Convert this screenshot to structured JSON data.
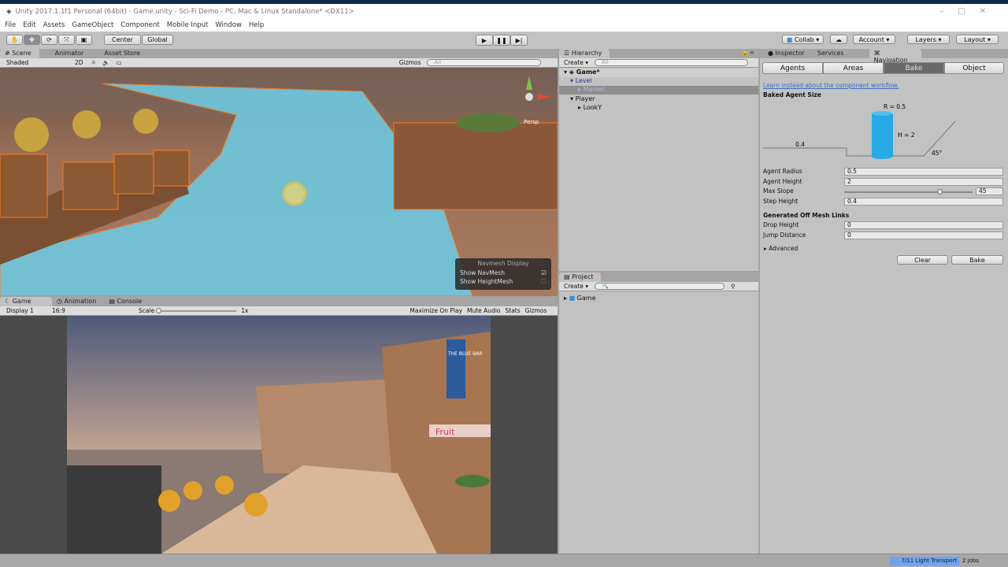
{
  "window": {
    "title": "Unity 2017.1.1f1 Personal (64bit) - Game.unity - Sci-Fi Demo - PC, Mac & Linux Standalone* <DX11>"
  },
  "menu": [
    "File",
    "Edit",
    "Assets",
    "GameObject",
    "Component",
    "Mobile Input",
    "Window",
    "Help"
  ],
  "toolbar": {
    "tools": [
      "hand-icon",
      "move-icon",
      "rotate-icon",
      "scale-icon",
      "rect-icon"
    ],
    "center": "Center",
    "global": "Global",
    "collab": "Collab",
    "account": "Account",
    "layers": "Layers",
    "layout": "Layout"
  },
  "scene": {
    "tabs": [
      "Scene",
      "Animator",
      "Asset Store"
    ],
    "shading": "Shaded",
    "mode2d": "2D",
    "gizmos": "Gizmos",
    "search_placeholder": "All",
    "persp": "Persp",
    "navmesh_display": {
      "title": "Navmesh Display",
      "show_navmesh": "Show NavMesh",
      "show_navmesh_checked": true,
      "show_heightmesh": "Show HeightMesh",
      "show_heightmesh_checked": false
    }
  },
  "game": {
    "tabs": [
      "Game",
      "Animation",
      "Console"
    ],
    "display": "Display 1",
    "aspect": "16:9",
    "scale_label": "Scale",
    "scale_value": "1x",
    "maximize": "Maximize On Play",
    "mute": "Mute Audio",
    "stats": "Stats",
    "gizmos": "Gizmos",
    "sign_bar": "THE BLUE BAR",
    "sign_fruit": "Fruit"
  },
  "hierarchy": {
    "tab": "Hierarchy",
    "create": "Create",
    "search_placeholder": "All",
    "scene": "Game*",
    "items": [
      {
        "label": "Level",
        "depth": 1
      },
      {
        "label": "Market",
        "depth": 2,
        "selected": true
      },
      {
        "label": "Player",
        "depth": 1
      },
      {
        "label": "LookY",
        "depth": 2
      }
    ]
  },
  "project": {
    "tab": "Project",
    "create": "Create",
    "items": [
      "Game"
    ]
  },
  "inspector": {
    "tabs": [
      "Inspector",
      "Services",
      "Navigation"
    ],
    "nav_tabs": [
      "Agents",
      "Areas",
      "Bake",
      "Object"
    ],
    "active_nav_tab": "Bake",
    "link": "Learn instead about the component workflow.",
    "baked_agent_size": "Baked Agent Size",
    "diagram": {
      "radius": "R = 0.5",
      "height": "H = 2",
      "step": "0.4",
      "slope": "45°"
    },
    "fields": [
      {
        "label": "Agent Radius",
        "value": "0.5"
      },
      {
        "label": "Agent Height",
        "value": "2"
      },
      {
        "label": "Max Slope",
        "value": "45",
        "slider_max": 60
      },
      {
        "label": "Step Height",
        "value": "0.4"
      }
    ],
    "offmesh_title": "Generated Off Mesh Links",
    "offmesh": [
      {
        "label": "Drop Height",
        "value": "0"
      },
      {
        "label": "Jump Distance",
        "value": "0"
      }
    ],
    "advanced": "Advanced",
    "clear": "Clear",
    "bake": "Bake"
  },
  "status": {
    "progress": "7/11 Light Transport",
    "jobs": "2 jobs"
  },
  "colors": {
    "accent": "#3d8fd9",
    "navmesh": "#6fc8e0",
    "selection_outline": "#ff7a1a"
  }
}
